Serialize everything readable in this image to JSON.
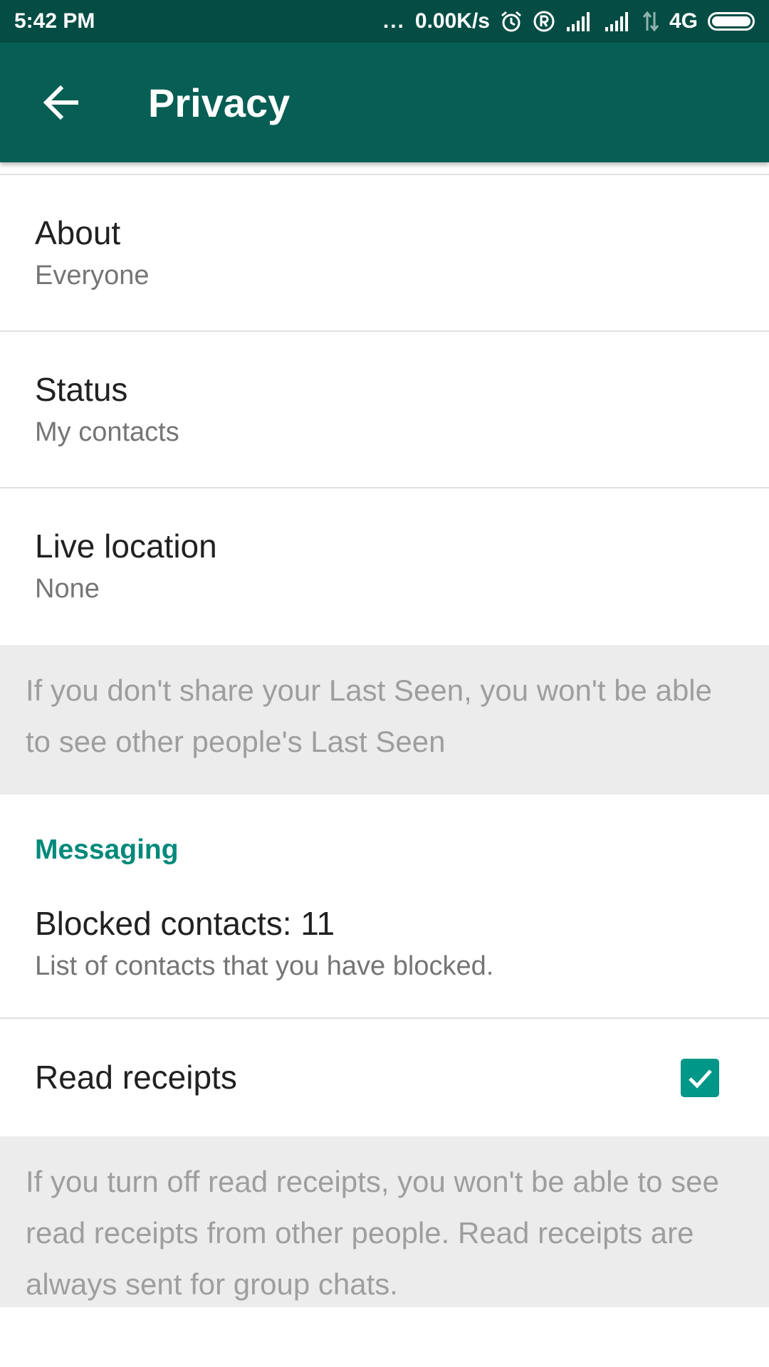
{
  "status_bar": {
    "time": "5:42 PM",
    "dots": "...",
    "net_speed": "0.00K/s",
    "network": "4G",
    "icons": [
      "alarm-icon",
      "registered-icon",
      "signal-icon",
      "signal-icon",
      "data-arrows-icon",
      "battery-icon"
    ]
  },
  "app_bar": {
    "title": "Privacy",
    "back_icon": "arrow-back-icon"
  },
  "items": {
    "about": {
      "title": "About",
      "value": "Everyone"
    },
    "status": {
      "title": "Status",
      "value": "My contacts"
    },
    "live_location": {
      "title": "Live location",
      "value": "None"
    }
  },
  "last_seen_info": "If you don't share your Last Seen, you won't be able to see other people's Last Seen",
  "messaging": {
    "header": "Messaging",
    "blocked": {
      "title": "Blocked contacts: 11",
      "subtitle": "List of contacts that you have blocked."
    },
    "read_receipts": {
      "title": "Read receipts",
      "checked": true
    }
  },
  "read_receipts_info": "If you turn off read receipts, you won't be able to see read receipts from other people. Read receipts are always sent for group chats.",
  "colors": {
    "status_bar": "#054d44",
    "app_bar": "#075e54",
    "accent": "#00897b",
    "checkbox": "#009688",
    "info_background": "#ececec"
  }
}
